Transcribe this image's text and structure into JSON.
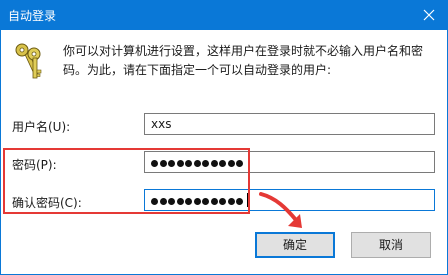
{
  "window": {
    "title": "自动登录"
  },
  "info": {
    "line1": "你可以对计算机进行设置，这样用户在登录时就不必输入用户名和密",
    "line2": "码。为此，请在下面指定一个可以自动登录的用户:"
  },
  "form": {
    "username_label": "用户名(U):",
    "username_value": "xxs",
    "password_label": "密码(P):",
    "password_dot_count": 11,
    "confirm_label": "确认密码(C):",
    "confirm_dot_count": 11
  },
  "buttons": {
    "ok": "确定",
    "cancel": "取消"
  },
  "colors": {
    "accent": "#0a78d7",
    "annotation": "#e53935"
  },
  "icons": {
    "window_close": "close-icon",
    "dialog": "keys-icon",
    "annotation_arrow": "arrow-icon"
  }
}
